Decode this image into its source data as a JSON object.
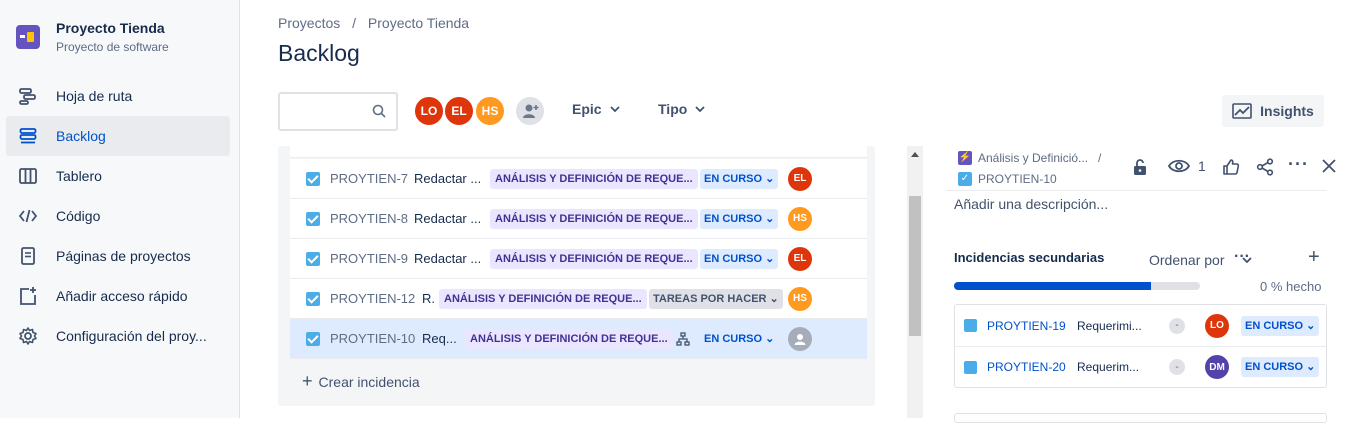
{
  "sidebar": {
    "project_name": "Proyecto Tienda",
    "project_type": "Proyecto de software",
    "items": [
      {
        "label": "Hoja de ruta",
        "icon": "roadmap-icon"
      },
      {
        "label": "Backlog",
        "icon": "backlog-icon",
        "active": true
      },
      {
        "label": "Tablero",
        "icon": "board-icon"
      },
      {
        "label": "Código",
        "icon": "code-icon"
      },
      {
        "label": "Páginas de proyectos",
        "icon": "pages-icon"
      },
      {
        "label": "Añadir acceso rápido",
        "icon": "add-shortcut-icon"
      },
      {
        "label": "Configuración del proy...",
        "icon": "settings-icon"
      }
    ]
  },
  "breadcrumb": {
    "root": "Proyectos",
    "sep": "/",
    "project": "Proyecto Tienda"
  },
  "page_title": "Backlog",
  "toolbar": {
    "search_placeholder": "",
    "avatars": [
      {
        "initials": "LO",
        "color": "#de350b"
      },
      {
        "initials": "EL",
        "color": "#de350b"
      },
      {
        "initials": "HS",
        "color": "#ff991f"
      }
    ],
    "epic_label": "Epic",
    "type_label": "Tipo",
    "insights_label": "Insights"
  },
  "backlog": {
    "rows": [
      {
        "key": "PROYTIEN-7",
        "summary": "Redactar ...",
        "epic": "ANÁLISIS Y DEFINICIÓN DE REQUE...",
        "status": "EN CURSO",
        "assignee": "EL",
        "assignee_color": "#de350b"
      },
      {
        "key": "PROYTIEN-8",
        "summary": "Redactar ...",
        "epic": "ANÁLISIS Y DEFINICIÓN DE REQUE...",
        "status": "EN CURSO",
        "assignee": "HS",
        "assignee_color": "#ff991f"
      },
      {
        "key": "PROYTIEN-9",
        "summary": "Redactar ...",
        "epic": "ANÁLISIS Y DEFINICIÓN DE REQUE...",
        "status": "EN CURSO",
        "assignee": "EL",
        "assignee_color": "#de350b"
      },
      {
        "key": "PROYTIEN-12",
        "summary": "R.",
        "epic": "ANÁLISIS Y DEFINICIÓN DE REQUE...",
        "status": "TAREAS POR HACER",
        "assignee": "HS",
        "assignee_color": "#ff991f"
      },
      {
        "key": "PROYTIEN-10",
        "summary": "Req...",
        "epic": "ANÁLISIS Y DEFINICIÓN DE REQUE...",
        "status": "EN CURSO",
        "assignee": "",
        "assignee_color": "#a5adba"
      }
    ],
    "create_label": "Crear incidencia"
  },
  "detail": {
    "epic_crumb": "Análisis y Definició...",
    "crumb_sep": "/",
    "issue_crumb": "PROYTIEN-10",
    "watchers": "1",
    "description_placeholder": "Añadir una descripción...",
    "subtasks_title": "Incidencias secundarias",
    "sort_label": "Ordenar por",
    "progress": 0.0,
    "progress_bar_fill": 0.8,
    "progress_text": "0 % hecho",
    "subtasks": [
      {
        "key": "PROYTIEN-19",
        "summary": "Requerimi...",
        "priority": "-",
        "assignee": "LO",
        "assignee_color": "#de350b",
        "status": "EN CURSO"
      },
      {
        "key": "PROYTIEN-20",
        "summary": "Requerim...",
        "priority": "-",
        "assignee": "DM",
        "assignee_color": "#5243aa",
        "status": "EN CURSO"
      }
    ]
  }
}
